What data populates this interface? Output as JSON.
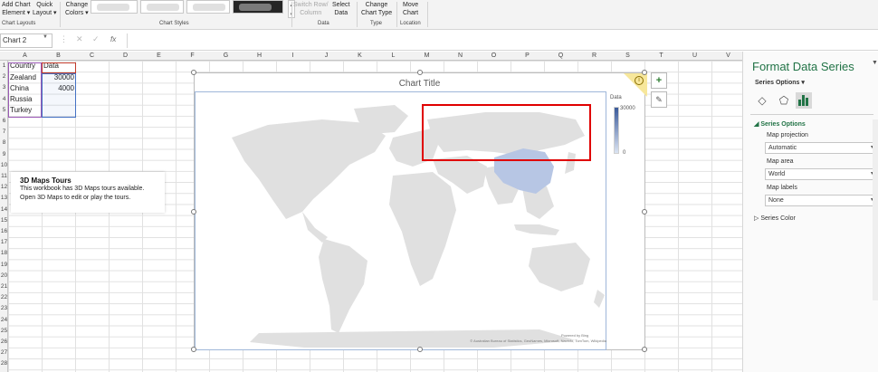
{
  "ribbon": {
    "add_chart_element": [
      "Add Chart",
      "Element ▾"
    ],
    "quick_layout": [
      "Quick",
      "Layout ▾"
    ],
    "change_colors": [
      "Change",
      "Colors ▾"
    ],
    "switch_row_column": [
      "Switch Row/",
      "Column"
    ],
    "select_data": [
      "Select",
      "Data"
    ],
    "change_chart_type": [
      "Change",
      "Chart Type"
    ],
    "move_chart": [
      "Move",
      "Chart"
    ],
    "groups": {
      "chart_layouts": "Chart Layouts",
      "chart_styles": "Chart Styles",
      "data": "Data",
      "type": "Type",
      "location": "Location"
    }
  },
  "formula_bar": {
    "name_box": "Chart 2",
    "fx": "fx",
    "formula": ""
  },
  "sheet": {
    "columns": [
      "A",
      "B",
      "C",
      "D",
      "E",
      "F",
      "G",
      "H",
      "I",
      "J",
      "K",
      "L",
      "M",
      "N",
      "O",
      "P",
      "Q",
      "R",
      "S",
      "T",
      "U",
      "V"
    ],
    "rows": [
      "1",
      "2",
      "3",
      "4",
      "5",
      "6",
      "7",
      "8",
      "9",
      "10",
      "11",
      "12",
      "13",
      "14",
      "15",
      "16",
      "17",
      "18",
      "19",
      "20",
      "21",
      "22",
      "23",
      "24",
      "25",
      "26",
      "27",
      "28"
    ],
    "cells": {
      "A1": "Country",
      "B1": "Data",
      "A2": "Zealand",
      "B2": "30000",
      "A3": "China",
      "B3": "4000",
      "A4": "Russia",
      "A5": "Turkey"
    }
  },
  "tours": {
    "title": "3D Maps Tours",
    "line1": "This workbook has 3D Maps tours available.",
    "line2": "Open 3D Maps to edit or play the tours."
  },
  "chart": {
    "title": "Chart Title",
    "legend_title": "Data",
    "legend_max": "30000",
    "legend_min": "0",
    "info_icon": "i",
    "powered": "Powered by Bing",
    "attribution": "© Australian Bureau of Statistics, GeoNames, Microsoft, Navinfo, TomTom, Wikipedia",
    "colors": {
      "land": "#e0e0e0",
      "china": "#b7c6e4",
      "legend_high": "#3a5a9a",
      "legend_low": "#dbe4f2",
      "highlight": "#e00000"
    }
  },
  "chart_data": {
    "type": "map",
    "title": "Chart Title",
    "series_name": "Data",
    "regions": [
      {
        "name": "Zealand",
        "value": 30000
      },
      {
        "name": "China",
        "value": 4000
      },
      {
        "name": "Russia",
        "value": null
      },
      {
        "name": "Turkey",
        "value": null
      }
    ],
    "legend": {
      "title": "Data",
      "max": 30000,
      "min": 0
    },
    "map_area": "World"
  },
  "side_buttons": {
    "plus": "+",
    "brush": "✎"
  },
  "pane": {
    "title": "Format Data Series",
    "series_options_dd": "Series Options ▾",
    "section_series_options": "Series Options",
    "map_projection_label": "Map projection",
    "map_projection_value": "Automatic",
    "map_area_label": "Map area",
    "map_area_value": "World",
    "map_labels_label": "Map labels",
    "map_labels_value": "None",
    "section_series_color": "Series Color",
    "icons": {
      "fill": "◇",
      "effects": "⬠"
    }
  }
}
